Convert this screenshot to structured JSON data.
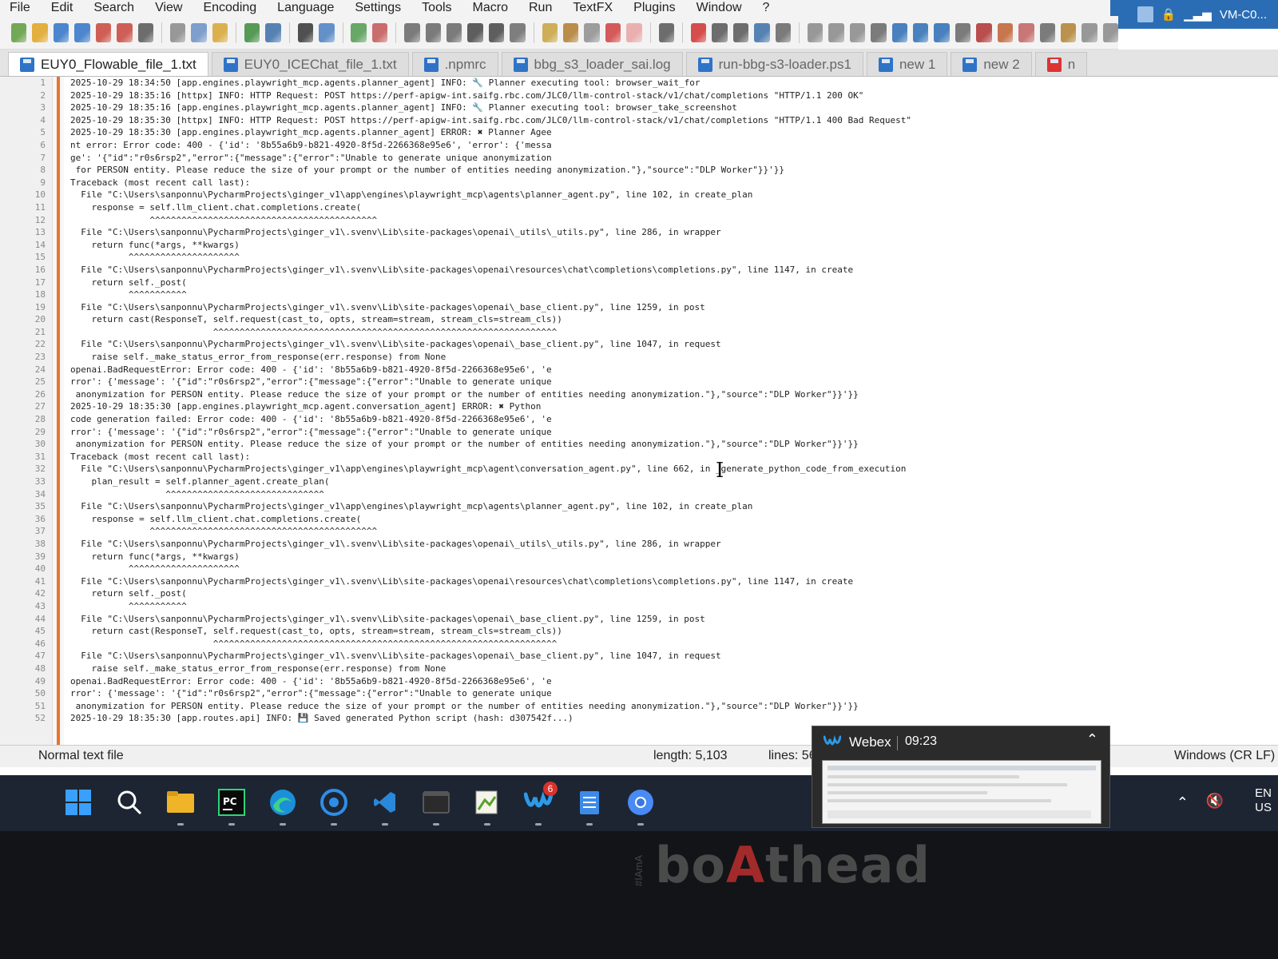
{
  "menu": [
    "File",
    "Edit",
    "Search",
    "View",
    "Encoding",
    "Language",
    "Settings",
    "Tools",
    "Macro",
    "Run",
    "TextFX",
    "Plugins",
    "Window",
    "?"
  ],
  "vm_label": "VM-C0...",
  "tabs": [
    {
      "label": "EUY0_Flowable_file_1.txt",
      "active": true
    },
    {
      "label": "EUY0_ICEChat_file_1.txt",
      "active": false
    },
    {
      "label": ".npmrc",
      "active": false
    },
    {
      "label": "bbg_s3_loader_sai.log",
      "active": false
    },
    {
      "label": "run-bbg-s3-loader.ps1",
      "active": false
    },
    {
      "label": "new 1",
      "active": false
    },
    {
      "label": "new 2",
      "active": false
    },
    {
      "label": "n",
      "active": false
    }
  ],
  "code_lines": [
    "2025-10-29 18:34:50 [app.engines.playwright_mcp.agents.planner_agent] INFO: 🔧 Planner executing tool: browser_wait_for",
    "2025-10-29 18:35:16 [httpx] INFO: HTTP Request: POST https://perf-apigw-int.saifg.rbc.com/JLC0/llm-control-stack/v1/chat/completions \"HTTP/1.1 200 OK\"",
    "2025-10-29 18:35:16 [app.engines.playwright_mcp.agents.planner_agent] INFO: 🔧 Planner executing tool: browser_take_screenshot",
    "2025-10-29 18:35:30 [httpx] INFO: HTTP Request: POST https://perf-apigw-int.saifg.rbc.com/JLC0/llm-control-stack/v1/chat/completions \"HTTP/1.1 400 Bad Request\"",
    "2025-10-29 18:35:30 [app.engines.playwright_mcp.agents.planner_agent] ERROR: ✖ Planner Agee",
    "nt error: Error code: 400 - {'id': '8b55a6b9-b821-4920-8f5d-2266368e95e6', 'error': {'messa",
    "ge': '{\"id\":\"r0s6rsp2\",\"error\":{\"message\":{\"error\":\"Unable to generate unique anonymization",
    " for PERSON entity. Please reduce the size of your prompt or the number of entities needing anonymization.\"},\"source\":\"DLP Worker\"}}'}}",
    "Traceback (most recent call last):",
    "  File \"C:\\Users\\sanponnu\\PycharmProjects\\ginger_v1\\app\\engines\\playwright_mcp\\agents\\planner_agent.py\", line 102, in create_plan",
    "    response = self.llm_client.chat.completions.create(",
    "               ^^^^^^^^^^^^^^^^^^^^^^^^^^^^^^^^^^^^^^^^^^^",
    "  File \"C:\\Users\\sanponnu\\PycharmProjects\\ginger_v1\\.svenv\\Lib\\site-packages\\openai\\_utils\\_utils.py\", line 286, in wrapper",
    "    return func(*args, **kwargs)",
    "           ^^^^^^^^^^^^^^^^^^^^^",
    "  File \"C:\\Users\\sanponnu\\PycharmProjects\\ginger_v1\\.svenv\\Lib\\site-packages\\openai\\resources\\chat\\completions\\completions.py\", line 1147, in create",
    "    return self._post(",
    "           ^^^^^^^^^^^",
    "  File \"C:\\Users\\sanponnu\\PycharmProjects\\ginger_v1\\.svenv\\Lib\\site-packages\\openai\\_base_client.py\", line 1259, in post",
    "    return cast(ResponseT, self.request(cast_to, opts, stream=stream, stream_cls=stream_cls))",
    "                           ^^^^^^^^^^^^^^^^^^^^^^^^^^^^^^^^^^^^^^^^^^^^^^^^^^^^^^^^^^^^^^^^^",
    "  File \"C:\\Users\\sanponnu\\PycharmProjects\\ginger_v1\\.svenv\\Lib\\site-packages\\openai\\_base_client.py\", line 1047, in request",
    "    raise self._make_status_error_from_response(err.response) from None",
    "openai.BadRequestError: Error code: 400 - {'id': '8b55a6b9-b821-4920-8f5d-2266368e95e6', 'e",
    "rror': {'message': '{\"id\":\"r0s6rsp2\",\"error\":{\"message\":{\"error\":\"Unable to generate unique",
    " anonymization for PERSON entity. Please reduce the size of your prompt or the number of entities needing anonymization.\"},\"source\":\"DLP Worker\"}}'}}",
    "2025-10-29 18:35:30 [app.engines.playwright_mcp.agent.conversation_agent] ERROR: ✖ Python",
    "code generation failed: Error code: 400 - {'id': '8b55a6b9-b821-4920-8f5d-2266368e95e6', 'e",
    "rror': {'message': '{\"id\":\"r0s6rsp2\",\"error\":{\"message\":{\"error\":\"Unable to generate unique",
    " anonymization for PERSON entity. Please reduce the size of your prompt or the number of entities needing anonymization.\"},\"source\":\"DLP Worker\"}}'}}",
    "Traceback (most recent call last):",
    "  File \"C:\\Users\\sanponnu\\PycharmProjects\\ginger_v1\\app\\engines\\playwright_mcp\\agent\\conversation_agent.py\", line 662, in _generate_python_code_from_execution",
    "    plan_result = self.planner_agent.create_plan(",
    "                  ^^^^^^^^^^^^^^^^^^^^^^^^^^^^^^",
    "  File \"C:\\Users\\sanponnu\\PycharmProjects\\ginger_v1\\app\\engines\\playwright_mcp\\agents\\planner_agent.py\", line 102, in create_plan",
    "    response = self.llm_client.chat.completions.create(",
    "               ^^^^^^^^^^^^^^^^^^^^^^^^^^^^^^^^^^^^^^^^^^^",
    "  File \"C:\\Users\\sanponnu\\PycharmProjects\\ginger_v1\\.svenv\\Lib\\site-packages\\openai\\_utils\\_utils.py\", line 286, in wrapper",
    "    return func(*args, **kwargs)",
    "           ^^^^^^^^^^^^^^^^^^^^^",
    "  File \"C:\\Users\\sanponnu\\PycharmProjects\\ginger_v1\\.svenv\\Lib\\site-packages\\openai\\resources\\chat\\completions\\completions.py\", line 1147, in create",
    "    return self._post(",
    "           ^^^^^^^^^^^",
    "  File \"C:\\Users\\sanponnu\\PycharmProjects\\ginger_v1\\.svenv\\Lib\\site-packages\\openai\\_base_client.py\", line 1259, in post",
    "    return cast(ResponseT, self.request(cast_to, opts, stream=stream, stream_cls=stream_cls))",
    "                           ^^^^^^^^^^^^^^^^^^^^^^^^^^^^^^^^^^^^^^^^^^^^^^^^^^^^^^^^^^^^^^^^^",
    "  File \"C:\\Users\\sanponnu\\PycharmProjects\\ginger_v1\\.svenv\\Lib\\site-packages\\openai\\_base_client.py\", line 1047, in request",
    "    raise self._make_status_error_from_response(err.response) from None",
    "openai.BadRequestError: Error code: 400 - {'id': '8b55a6b9-b821-4920-8f5d-2266368e95e6', 'e",
    "rror': {'message': '{\"id\":\"r0s6rsp2\",\"error\":{\"message\":{\"error\":\"Unable to generate unique",
    " anonymization for PERSON entity. Please reduce the size of your prompt or the number of entities needing anonymization.\"},\"source\":\"DLP Worker\"}}'}}",
    "2025-10-29 18:35:30 [app.routes.api] INFO: 💾 Saved generated Python script (hash: d307542f...)"
  ],
  "status": {
    "file_type": "Normal text file",
    "length": "length: 5,103",
    "lines": "lines: 56",
    "eol": "Windows (CR LF)"
  },
  "webex": {
    "title": "Webex",
    "time": "09:23"
  },
  "taskbar": {
    "apps": [
      "windows-start",
      "search",
      "file-explorer",
      "pycharm",
      "edge",
      "app-blue-circle",
      "vscode",
      "terminal",
      "notepad-plus-plus",
      "webex",
      "notepad",
      "chrome"
    ],
    "webex_badge": "6"
  },
  "tray": {
    "lang": "EN",
    "region": "US"
  },
  "brand": "boAthead",
  "brand_side": "#IAmA",
  "colors": {
    "fold_bar": "#e8742c",
    "tab_icon": "#2f73c7",
    "taskbar_bg": "#1d2533",
    "vm_badge": "#2a6db5"
  }
}
